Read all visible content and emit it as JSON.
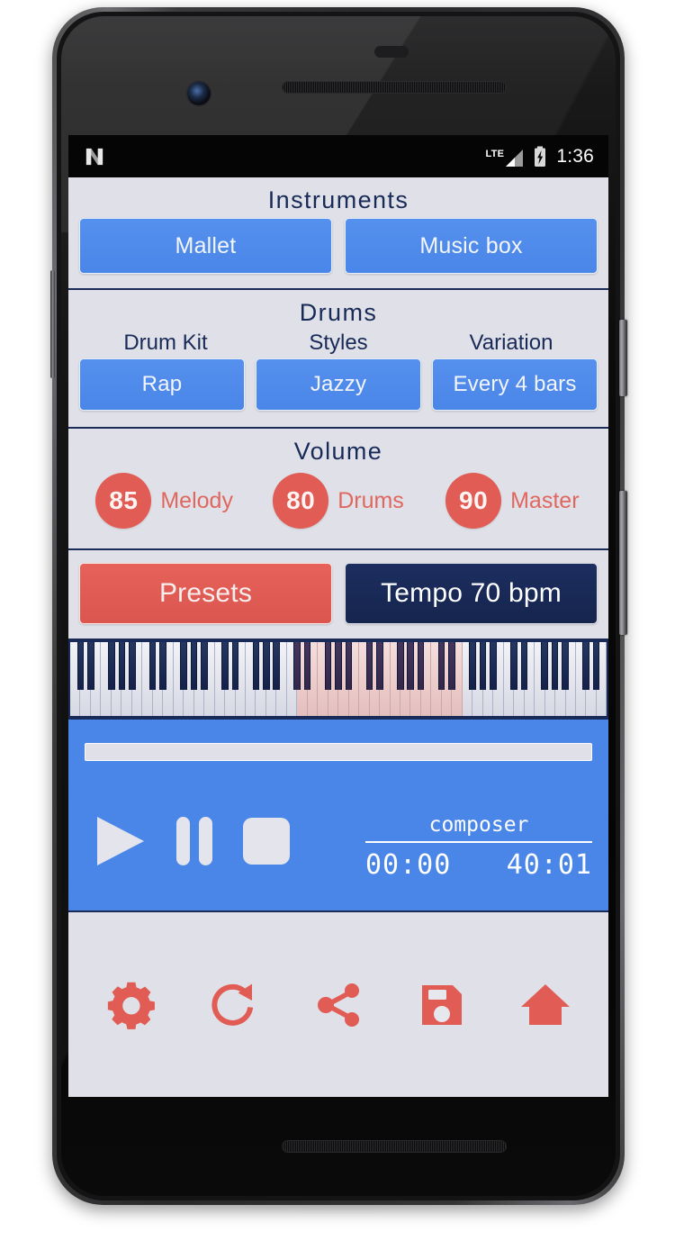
{
  "status_bar": {
    "android_logo": "android-n-icon",
    "network": "LTE",
    "signal": "signal-icon",
    "battery": "battery-charging-icon",
    "time": "1:36"
  },
  "instruments": {
    "title": "Instruments",
    "buttons": [
      {
        "label": "Mallet",
        "name": "instrument-mallet"
      },
      {
        "label": "Music box",
        "name": "instrument-music-box"
      }
    ]
  },
  "drums": {
    "title": "Drums",
    "columns": [
      {
        "label": "Drum Kit",
        "value": "Rap"
      },
      {
        "label": "Styles",
        "value": "Jazzy"
      },
      {
        "label": "Variation",
        "value": "Every 4 bars"
      }
    ]
  },
  "volume": {
    "title": "Volume",
    "items": [
      {
        "value": "85",
        "label": "Melody"
      },
      {
        "value": "80",
        "label": "Drums"
      },
      {
        "value": "90",
        "label": "Master"
      }
    ]
  },
  "actions": {
    "presets_label": "Presets",
    "tempo_label": "Tempo 70 bpm",
    "tempo_bpm": 70
  },
  "piano": {
    "white_keys": 52,
    "highlight_start_white_key": 22,
    "highlight_end_white_key": 38
  },
  "player": {
    "progress_percent": 0,
    "composer": "composer",
    "elapsed": "00:00",
    "total": "40:01",
    "controls": [
      "play",
      "pause",
      "stop"
    ]
  },
  "toolbar": {
    "icons": [
      {
        "name": "gear-icon",
        "label": "Settings"
      },
      {
        "name": "refresh-icon",
        "label": "Reload"
      },
      {
        "name": "share-icon",
        "label": "Share"
      },
      {
        "name": "save-icon",
        "label": "Save"
      },
      {
        "name": "home-icon",
        "label": "Home"
      }
    ]
  },
  "colors": {
    "blue": "#4a86e8",
    "red": "#e05c54",
    "navy": "#182a57",
    "panel_bg": "#e0e1e8",
    "piano_highlight": "#eccccb"
  }
}
